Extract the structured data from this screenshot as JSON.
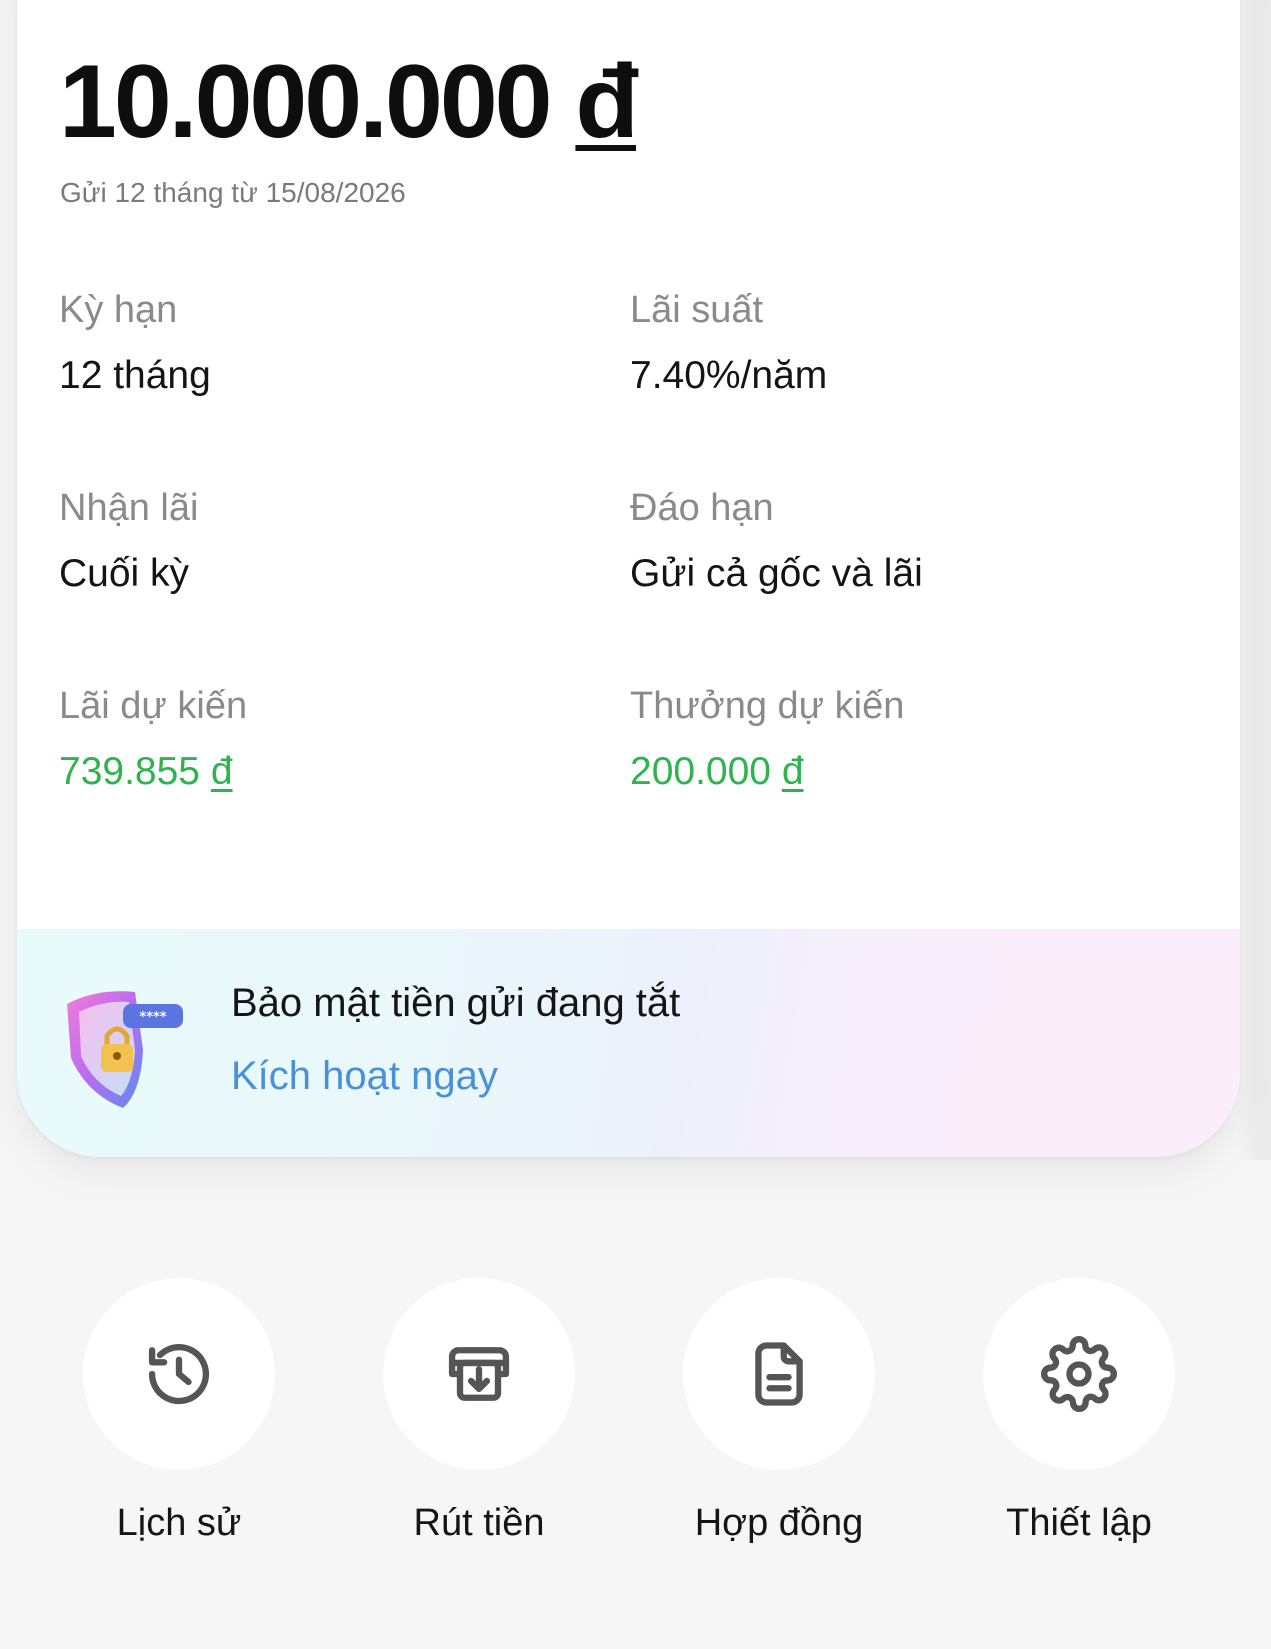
{
  "deposit": {
    "amount": "10.000.000",
    "currency": "đ",
    "subtitle": "Gửi 12 tháng từ 15/08/2026"
  },
  "details": {
    "term_label": "Kỳ hạn",
    "term_value": "12 tháng",
    "rate_label": "Lãi suất",
    "rate_value": "7.40%/năm",
    "interest_receipt_label": "Nhận lãi",
    "interest_receipt_value": "Cuối kỳ",
    "maturity_label": "Đáo hạn",
    "maturity_value": "Gửi cả gốc và lãi",
    "expected_interest_label": "Lãi dự kiến",
    "expected_interest_value": "739.855",
    "expected_bonus_label": "Thưởng dự kiến",
    "expected_bonus_value": "200.000",
    "currency": "đ"
  },
  "security": {
    "title": "Bảo mật tiền gửi đang tắt",
    "action": "Kích hoạt ngay",
    "badge_text": "****",
    "icon": "shield-lock-icon"
  },
  "actions": [
    {
      "label": "Lịch sử",
      "icon": "history-icon"
    },
    {
      "label": "Rút tiền",
      "icon": "withdraw-icon"
    },
    {
      "label": "Hợp đồng",
      "icon": "document-icon"
    },
    {
      "label": "Thiết lập",
      "icon": "gear-icon"
    }
  ],
  "colors": {
    "positive": "#2eb34f",
    "link": "#4a90d9",
    "text": "#111111",
    "muted": "#8a8a8a",
    "background": "#f6f6f6",
    "icon": "#555555"
  }
}
